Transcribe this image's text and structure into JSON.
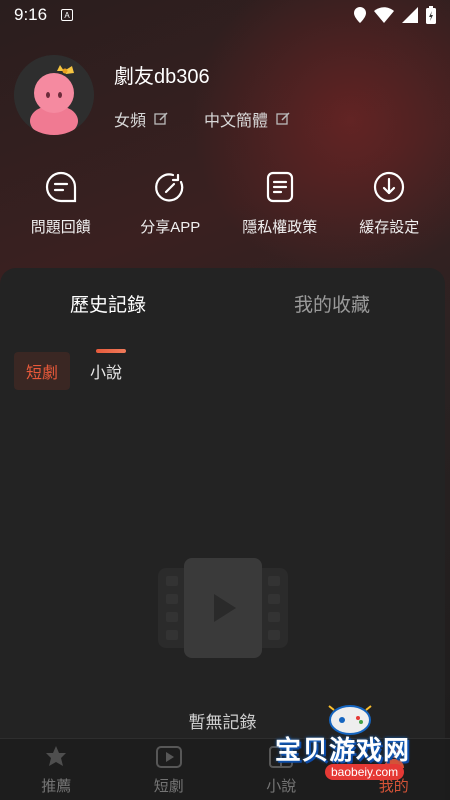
{
  "status_bar": {
    "time": "9:16",
    "notification_icon": "A"
  },
  "profile": {
    "username": "劇友db306",
    "gender_pref": "女頻",
    "language_pref": "中文簡體"
  },
  "actions": [
    {
      "label": "問題回饋",
      "icon": "feedback-icon"
    },
    {
      "label": "分享APP",
      "icon": "share-icon"
    },
    {
      "label": "隱私權政策",
      "icon": "document-icon"
    },
    {
      "label": "緩存設定",
      "icon": "download-icon"
    }
  ],
  "tabs": {
    "history": "歷史記錄",
    "favorites": "我的收藏"
  },
  "chips": {
    "short_drama": "短劇",
    "novel": "小說"
  },
  "empty": {
    "message": "暫無記錄"
  },
  "bottom_nav": [
    {
      "label": "推薦",
      "icon": "thumbs-up-icon"
    },
    {
      "label": "短劇",
      "icon": "play-icon"
    },
    {
      "label": "小說",
      "icon": "book-icon"
    },
    {
      "label": "我的",
      "icon": "user-icon"
    }
  ],
  "watermark": {
    "text": "宝贝游戏网",
    "url": "baobeiy.com"
  },
  "colors": {
    "accent": "#e8593a",
    "panel": "#232323",
    "background": "#2a1e1e"
  }
}
